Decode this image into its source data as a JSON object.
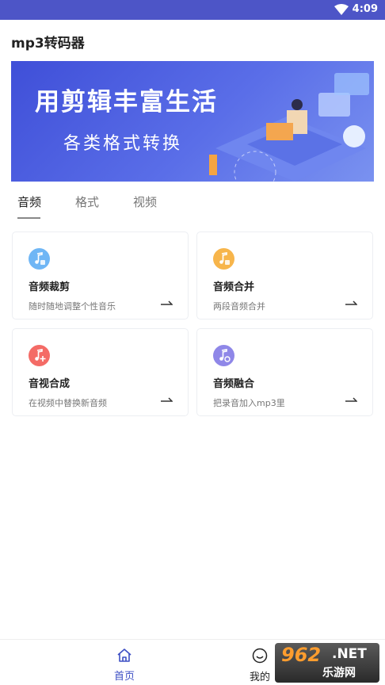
{
  "status_bar": {
    "time": "4:09"
  },
  "app_bar": {
    "title": "mp3转码器"
  },
  "banner": {
    "headline": "用剪辑丰富生活",
    "subline": "各类格式转换"
  },
  "tabs": [
    {
      "label": "音频",
      "active": true
    },
    {
      "label": "格式",
      "active": false
    },
    {
      "label": "视频",
      "active": false
    }
  ],
  "cards": [
    {
      "title": "音频裁剪",
      "desc": "随时随地调整个性音乐",
      "icon": "music-scissors-icon",
      "color": "#6fb6f5"
    },
    {
      "title": "音频合并",
      "desc": "两段音频合并",
      "icon": "music-merge-icon",
      "color": "#f7b54b"
    },
    {
      "title": "音视合成",
      "desc": "在视频中替换新音频",
      "icon": "music-add-icon",
      "color": "#f46b66"
    },
    {
      "title": "音频融合",
      "desc": "把录音加入mp3里",
      "icon": "music-mix-icon",
      "color": "#8f87e8"
    }
  ],
  "bottom_nav": [
    {
      "label": "首页",
      "icon": "home-icon",
      "active": true
    },
    {
      "label": "我的",
      "icon": "smiley-icon",
      "active": false
    }
  ],
  "watermark": {
    "brand": "962",
    "domain": ".NET",
    "name": "乐游网"
  },
  "colors": {
    "status_bar": "#4d55c7",
    "accent": "#3d4fc4"
  }
}
